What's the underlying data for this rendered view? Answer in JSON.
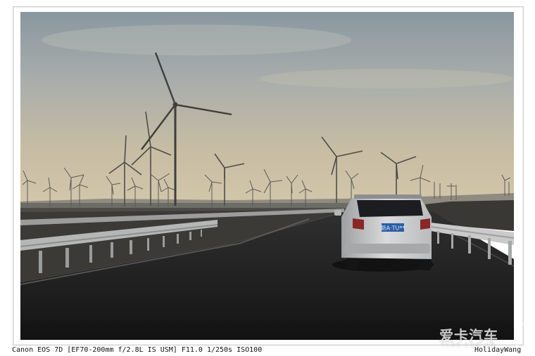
{
  "caption": "Canon EOS 7D [EF70-200mm f/2.8L IS USM] F11.0 1/250s ISO100",
  "credit": "HolidayWang",
  "watermark": {
    "text": "爱卡汽车",
    "sub": "XCAR.COM.CN"
  },
  "plate": "新A·TU**",
  "colors": {
    "sky_top": "#8d99a2",
    "sky_bottom": "#cdbfa1",
    "road": "#1e1e1e",
    "car": "#d7d8d8"
  }
}
